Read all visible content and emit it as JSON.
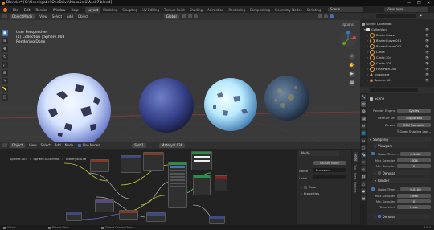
{
  "app": {
    "title": "Blender* [C:\\Users\\gabri\\OneDrive\\Masaüstü\\Ass07.blend]",
    "window_controls": [
      "—",
      "❐",
      "✕"
    ]
  },
  "menu": {
    "items": [
      "File",
      "Edit",
      "Render",
      "Window",
      "Help"
    ],
    "tabs": [
      "Layout",
      "Modeling",
      "Sculpting",
      "UV Editing",
      "Texture Paint",
      "Shading",
      "Animation",
      "Rendering",
      "Compositing",
      "Geometry Nodes",
      "Scripting"
    ],
    "active_tab": "Layout",
    "scene_label": "Scene",
    "view_layer_label": "ViewLayer"
  },
  "viewport": {
    "mode": "Object Mode",
    "menus": [
      "View",
      "Select",
      "Add",
      "Object"
    ],
    "orientation": "Global",
    "options_label": "Options",
    "overlay_lines": [
      "User Perspective",
      "(1) Collection | Sphere.003",
      "Rendering Done"
    ]
  },
  "node_editor": {
    "type_label": "Object",
    "menus": [
      "View",
      "Select",
      "Add",
      "Node"
    ],
    "use_nodes_label": "Use Nodes",
    "slot_label": "Slot 1",
    "material_name": "Materyal.036",
    "breadcrumb": [
      "Sphere.003",
      "Sphere.003.Mesh",
      "Materyal.036"
    ],
    "panel": {
      "tabs": [
        "Node",
        "Tool",
        "View",
        "Options"
      ],
      "section": "Node",
      "dropdown": "Pauser Node",
      "name_label": "Name",
      "name_value": "Emission",
      "label_label": "Label",
      "color_label": "Color",
      "properties_label": "Properties"
    }
  },
  "status_bar": {
    "items": [
      "Select",
      "Rotate View",
      "Object Context Menu"
    ],
    "version": "3.6.0"
  },
  "outliner": {
    "root": "Scene Collection",
    "collection": "Collection",
    "items": [
      "BezierCurve",
      "BezierCurve.001",
      "BezierCurve.002",
      "Circle",
      "Circle.104",
      "Circle.105",
      "FinalPath.002",
      "Icosphere",
      "Sphere.001"
    ]
  },
  "properties": {
    "scene_name": "Scene",
    "render_engine": {
      "label": "Render Engine",
      "value": "Cycles"
    },
    "feature_set": {
      "label": "Feature Set",
      "value": "Supported"
    },
    "device": {
      "label": "Device",
      "value": "GPU Compute"
    },
    "open_shading": "Open Shading Lan...",
    "sampling_label": "Sampling",
    "viewport_label": "Viewport",
    "v_noise": {
      "label": "Noise Thres...",
      "value": "0.1000"
    },
    "v_max": {
      "label": "Max Samples",
      "value": "1024"
    },
    "v_min": {
      "label": "Min Samples",
      "value": "0"
    },
    "v_denoise": "Denoise",
    "render_label": "Render",
    "r_noise": {
      "label": "Noise Thres...",
      "value": "0.0100"
    },
    "r_max": {
      "label": "Max Samples",
      "value": "4096"
    },
    "r_min": {
      "label": "Min Samples",
      "value": "0"
    },
    "r_time": {
      "label": "Time Limit",
      "value": "0 sec"
    },
    "r_denoise": "Denoise"
  },
  "colors": {
    "accent": "#4772b3",
    "blender_orange": "#e87d0d",
    "viewport_bg": "#3a3a3a"
  }
}
